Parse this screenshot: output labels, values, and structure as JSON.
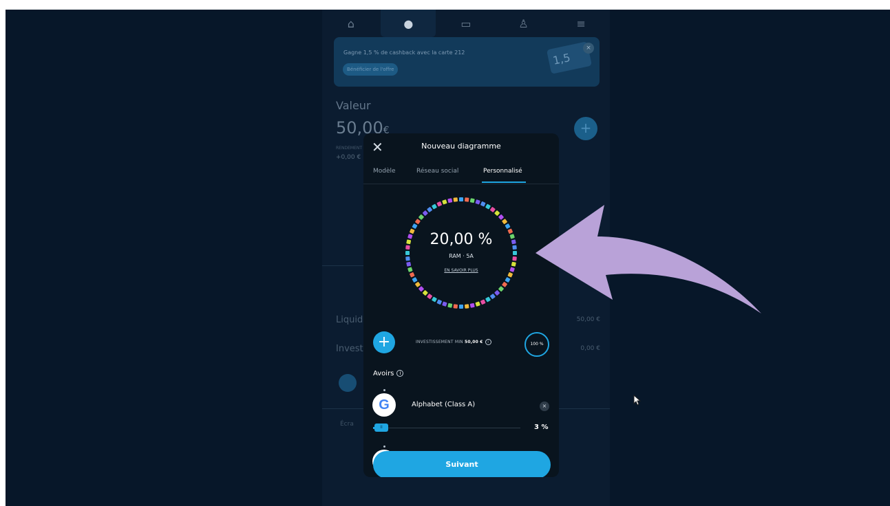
{
  "app": {
    "nav_icons": [
      "home-icon",
      "pie-chart-icon",
      "card-icon",
      "users-icon",
      "menu-icon"
    ],
    "banner": {
      "text": "Gagne 1,5 % de cashback avec la carte 212",
      "button_label": "Bénéficier de l'offre",
      "card_text": "1,5",
      "close": "×"
    },
    "value_label": "Valeur",
    "value_amount": "50,00",
    "value_currency": "€",
    "rendement_label": "RENDEMENT",
    "rendement_value": "+0,00 €",
    "plus": "+",
    "liquidites_label": "Liquidit",
    "liquidites_value": "50,00 €",
    "investis_label": "Investis",
    "investis_value": "0,00 €",
    "ecran_label": "Écra"
  },
  "modal": {
    "close": "✕",
    "title": "Nouveau diagramme",
    "tabs": [
      {
        "label": "Modèle"
      },
      {
        "label": "Réseau social"
      },
      {
        "label": "Personnalisé"
      }
    ],
    "active_tab": "Personnalisé",
    "ring": {
      "percent": "20,00 %",
      "subtitle": "RAM · 5A",
      "link": "EN SAVOIR PLUS",
      "segment_colors": [
        "#3da5f4",
        "#7b5cf0",
        "#e84fa3",
        "#f0b93b",
        "#6cd46c",
        "#37c8d8",
        "#b24ff0",
        "#f06a4f",
        "#4f8df0",
        "#d6e23b"
      ]
    },
    "add": "+",
    "invest_min_prefix": "INVESTISSEMENT MIN",
    "invest_min_value": "50,00 €",
    "info": "i",
    "allocation_pct": "100 %",
    "avoirs_label": "Avoirs",
    "holding": {
      "logo_letter": "G",
      "name": "Alphabet (Class A)",
      "remove": "×",
      "slider_thumb": "II",
      "percent": "3 %"
    },
    "next_button": "Suivant"
  },
  "colors": {
    "accent": "#1fa6e2",
    "background": "#071729",
    "modal": "#09141e",
    "annotation_arrow": "#b9a2d8"
  }
}
